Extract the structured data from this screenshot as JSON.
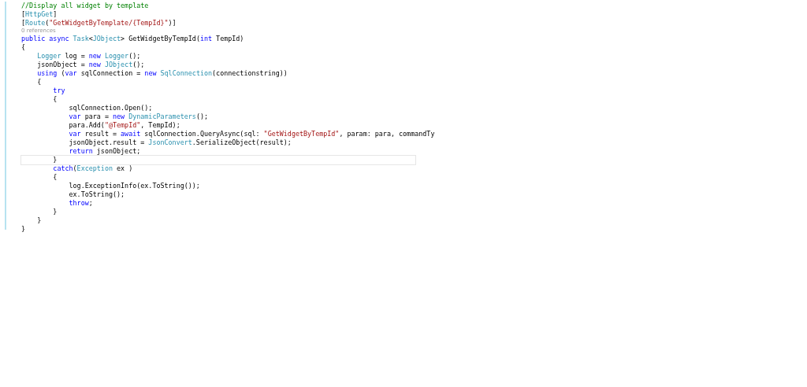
{
  "lines": [
    {
      "kind": "code",
      "current": false,
      "tokens": [
        {
          "kind": "comment",
          "text": "//Display all widget by template"
        }
      ]
    },
    {
      "kind": "code",
      "current": false,
      "tokens": [
        {
          "kind": "plain",
          "text": "["
        },
        {
          "kind": "type",
          "text": "HttpGet"
        },
        {
          "kind": "plain",
          "text": "]"
        }
      ]
    },
    {
      "kind": "code",
      "current": false,
      "tokens": [
        {
          "kind": "plain",
          "text": "["
        },
        {
          "kind": "type",
          "text": "Route"
        },
        {
          "kind": "plain",
          "text": "("
        },
        {
          "kind": "string",
          "text": "\"GetWidgetByTemplate/{TempId}\""
        },
        {
          "kind": "plain",
          "text": ")]"
        }
      ]
    },
    {
      "kind": "lens",
      "current": false,
      "tokens": [
        {
          "kind": "lens",
          "text": "0 references"
        }
      ]
    },
    {
      "kind": "code",
      "current": false,
      "tokens": [
        {
          "kind": "keyword",
          "text": "public async "
        },
        {
          "kind": "type",
          "text": "Task"
        },
        {
          "kind": "plain",
          "text": "<"
        },
        {
          "kind": "type",
          "text": "JObject"
        },
        {
          "kind": "plain",
          "text": "> GetWidgetByTempId("
        },
        {
          "kind": "keyword",
          "text": "int"
        },
        {
          "kind": "plain",
          "text": " TempId)"
        }
      ]
    },
    {
      "kind": "code",
      "current": false,
      "tokens": [
        {
          "kind": "plain",
          "text": "{"
        }
      ]
    },
    {
      "kind": "code",
      "current": false,
      "tokens": [
        {
          "kind": "type",
          "text": "    Logger"
        },
        {
          "kind": "plain",
          "text": " log = "
        },
        {
          "kind": "keyword",
          "text": "new "
        },
        {
          "kind": "type",
          "text": "Logger"
        },
        {
          "kind": "plain",
          "text": "();"
        }
      ]
    },
    {
      "kind": "code",
      "current": false,
      "tokens": [
        {
          "kind": "plain",
          "text": "    jsonObject = "
        },
        {
          "kind": "keyword",
          "text": "new "
        },
        {
          "kind": "type",
          "text": "JObject"
        },
        {
          "kind": "plain",
          "text": "();"
        }
      ]
    },
    {
      "kind": "code",
      "current": false,
      "tokens": [
        {
          "kind": "keyword",
          "text": "    using"
        },
        {
          "kind": "plain",
          "text": " ("
        },
        {
          "kind": "keyword",
          "text": "var"
        },
        {
          "kind": "plain",
          "text": " sqlConnection = "
        },
        {
          "kind": "keyword",
          "text": "new "
        },
        {
          "kind": "type",
          "text": "SqlConnection"
        },
        {
          "kind": "plain",
          "text": "(connectionstring))"
        }
      ]
    },
    {
      "kind": "code",
      "current": false,
      "tokens": [
        {
          "kind": "plain",
          "text": "    {"
        }
      ]
    },
    {
      "kind": "code",
      "current": false,
      "tokens": [
        {
          "kind": "keyword",
          "text": "        try"
        }
      ]
    },
    {
      "kind": "code",
      "current": false,
      "tokens": [
        {
          "kind": "plain",
          "text": "        {"
        }
      ]
    },
    {
      "kind": "code",
      "current": false,
      "tokens": [
        {
          "kind": "plain",
          "text": "            sqlConnection.Open();"
        }
      ]
    },
    {
      "kind": "code",
      "current": false,
      "tokens": [
        {
          "kind": "keyword",
          "text": "            var"
        },
        {
          "kind": "plain",
          "text": " para = "
        },
        {
          "kind": "keyword",
          "text": "new "
        },
        {
          "kind": "type",
          "text": "DynamicParameters"
        },
        {
          "kind": "plain",
          "text": "();"
        }
      ]
    },
    {
      "kind": "code",
      "current": false,
      "tokens": [
        {
          "kind": "plain",
          "text": "            para.Add("
        },
        {
          "kind": "string",
          "text": "\"@TempId\""
        },
        {
          "kind": "plain",
          "text": ", TempId);"
        }
      ]
    },
    {
      "kind": "code",
      "current": false,
      "tokens": [
        {
          "kind": "keyword",
          "text": "            var"
        },
        {
          "kind": "plain",
          "text": " result = "
        },
        {
          "kind": "keyword",
          "text": "await"
        },
        {
          "kind": "plain",
          "text": " sqlConnection.QueryAsync(sql: "
        },
        {
          "kind": "string",
          "text": "\"GetWidgetByTempId\""
        },
        {
          "kind": "plain",
          "text": ", param: para, commandTy"
        }
      ]
    },
    {
      "kind": "code",
      "current": false,
      "tokens": [
        {
          "kind": "plain",
          "text": "            jsonObject.result = "
        },
        {
          "kind": "type",
          "text": "JsonConvert"
        },
        {
          "kind": "plain",
          "text": ".SerializeObject(result);"
        }
      ]
    },
    {
      "kind": "code",
      "current": false,
      "tokens": [
        {
          "kind": "keyword",
          "text": "            return"
        },
        {
          "kind": "plain",
          "text": " jsonObject;"
        }
      ]
    },
    {
      "kind": "code",
      "current": true,
      "tokens": [
        {
          "kind": "plain",
          "text": "        }"
        }
      ]
    },
    {
      "kind": "code",
      "current": false,
      "tokens": [
        {
          "kind": "keyword",
          "text": "        catch"
        },
        {
          "kind": "plain",
          "text": "("
        },
        {
          "kind": "type",
          "text": "Exception"
        },
        {
          "kind": "plain",
          "text": " ex )"
        }
      ]
    },
    {
      "kind": "code",
      "current": false,
      "tokens": [
        {
          "kind": "plain",
          "text": "        {"
        }
      ]
    },
    {
      "kind": "code",
      "current": false,
      "tokens": [
        {
          "kind": "plain",
          "text": "            log.ExceptionInfo(ex.ToString());"
        }
      ]
    },
    {
      "kind": "code",
      "current": false,
      "tokens": [
        {
          "kind": "plain",
          "text": "            ex.ToString();"
        }
      ]
    },
    {
      "kind": "code",
      "current": false,
      "tokens": [
        {
          "kind": "keyword",
          "text": "            throw"
        },
        {
          "kind": "plain",
          "text": ";"
        }
      ]
    },
    {
      "kind": "code",
      "current": false,
      "tokens": [
        {
          "kind": "plain",
          "text": "        }"
        }
      ]
    },
    {
      "kind": "code",
      "current": false,
      "tokens": [
        {
          "kind": "plain",
          "text": "    }"
        }
      ]
    },
    {
      "kind": "code",
      "current": false,
      "tokens": [
        {
          "kind": "plain",
          "text": "}"
        }
      ]
    }
  ]
}
